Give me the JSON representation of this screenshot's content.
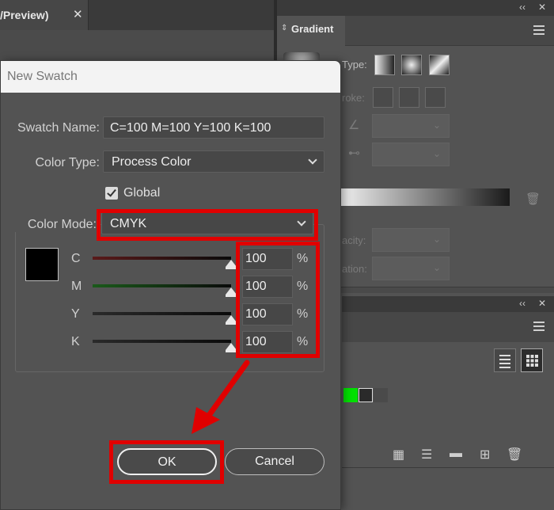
{
  "document": {
    "tab_title": "/Preview)",
    "close_glyph": "✕"
  },
  "gradient_panel": {
    "collapse_glyph": "‹‹",
    "close_glyph": "✕",
    "tab_label": "Gradient",
    "type_label": "Type:",
    "stroke_label": "roke:",
    "opacity_label": "acity:",
    "location_label": "ation:"
  },
  "swatches_panel": {
    "collapse_glyph": "‹‹",
    "close_glyph": "✕",
    "swatch_colors": [
      "#00e000",
      "#2a2a2a",
      "#4a4a4a"
    ]
  },
  "dialog": {
    "title": "New Swatch",
    "swatch_name_label": "Swatch Name:",
    "swatch_name_value": "C=100 M=100 Y=100 K=100",
    "color_type_label": "Color Type:",
    "color_type_value": "Process Color",
    "global_label": "Global",
    "global_checked": true,
    "color_mode_label": "Color Mode:",
    "color_mode_value": "CMYK",
    "preview_color": "#000000",
    "channels": [
      {
        "letter": "C",
        "value": "100",
        "unit": "%",
        "tint": "#5a1a1a"
      },
      {
        "letter": "M",
        "value": "100",
        "unit": "%",
        "tint": "#1a5a1a"
      },
      {
        "letter": "Y",
        "value": "100",
        "unit": "%",
        "tint": "#2a2a2a"
      },
      {
        "letter": "K",
        "value": "100",
        "unit": "%",
        "tint": "#2a2a2a"
      }
    ],
    "ok_label": "OK",
    "cancel_label": "Cancel"
  },
  "annotation_color": "#e00000"
}
